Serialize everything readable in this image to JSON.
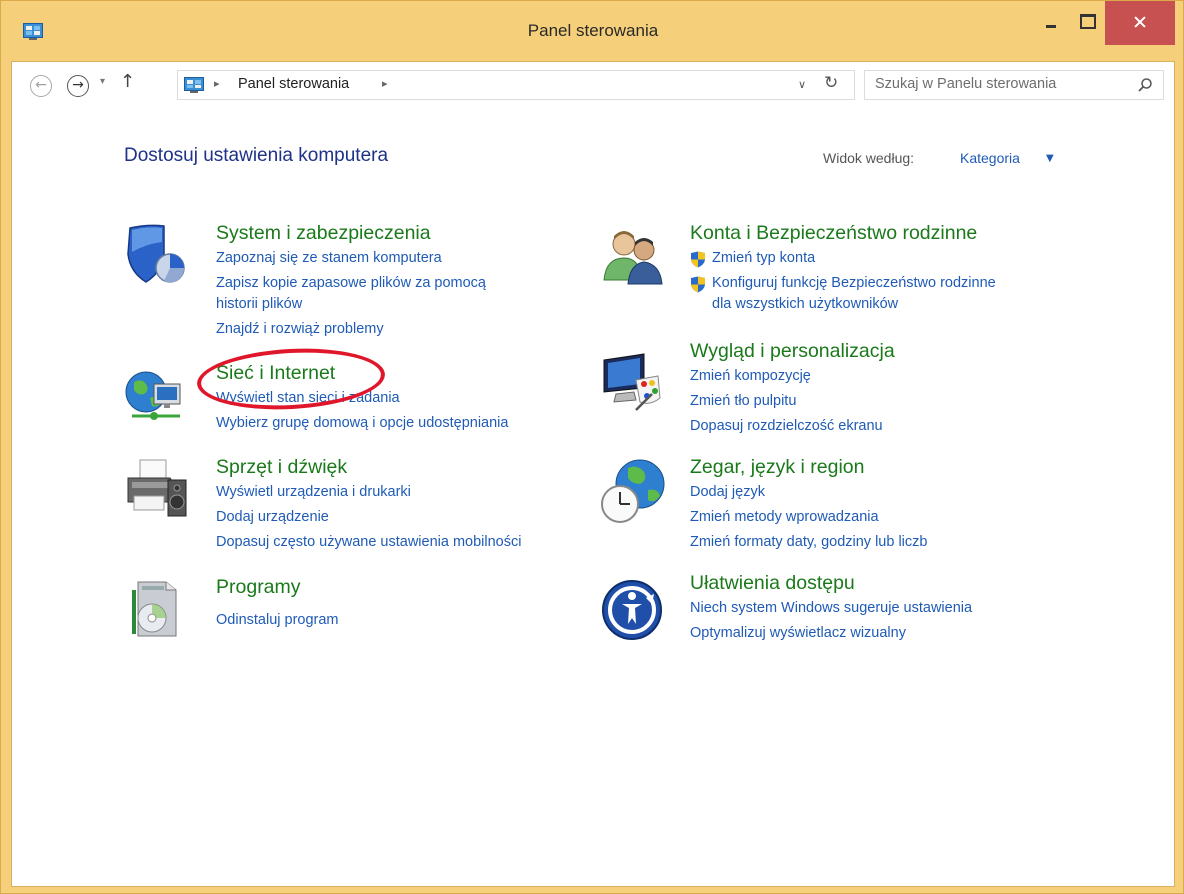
{
  "window": {
    "title": "Panel sterowania",
    "close_color": "#c75050",
    "frame_color": "#f5cf79"
  },
  "nav": {
    "back_icon": "←",
    "forward_icon": "→",
    "recent_icon": "▾",
    "up_icon": "↑",
    "breadcrumb_sep": "▸",
    "breadcrumb": "Panel sterowania",
    "address_dropdown_icon": "∨",
    "refresh_icon": "↻",
    "search_placeholder": "Szukaj w Panelu sterowania"
  },
  "header": {
    "title": "Dostosuj ustawienia komputera",
    "view_label": "Widok według:",
    "view_value": "Kategoria",
    "view_caret": "▼"
  },
  "categories": {
    "system": {
      "title": "System i zabezpieczenia",
      "icon": "shield-icon",
      "links": [
        "Zapoznaj się ze stanem komputera",
        "Zapisz kopie zapasowe plików za pomocą",
        "historii plików",
        "Znajdź i rozwiąż problemy"
      ]
    },
    "network": {
      "title": "Sieć i Internet",
      "icon": "network-globe-icon",
      "links": [
        "Wyświetl stan sieci i zadania",
        "Wybierz grupę domową i opcje udostępniania"
      ]
    },
    "hardware": {
      "title": "Sprzęt i dźwięk",
      "icon": "printer-icon",
      "links": [
        "Wyświetl urządzenia i drukarki",
        "Dodaj urządzenie",
        "Dopasuj często używane ustawienia mobilności"
      ]
    },
    "programs": {
      "title": "Programy",
      "icon": "programs-disc-icon",
      "links": [
        "Odinstaluj program"
      ]
    },
    "accounts": {
      "title": "Konta i Bezpieczeństwo rodzinne",
      "icon": "users-icon",
      "links": [
        "Zmień typ konta",
        "Konfiguruj funkcję Bezpieczeństwo rodzinne",
        "dla wszystkich użytkowników"
      ]
    },
    "appearance": {
      "title": "Wygląd i personalizacja",
      "icon": "monitor-palette-icon",
      "links": [
        "Zmień kompozycję",
        "Zmień tło pulpitu",
        "Dopasuj rozdzielczość ekranu"
      ]
    },
    "clock": {
      "title": "Zegar, język i region",
      "icon": "globe-clock-icon",
      "links": [
        "Dodaj język",
        "Zmień metody wprowadzania",
        "Zmień formaty daty, godziny lub liczb"
      ]
    },
    "ease": {
      "title": "Ułatwienia dostępu",
      "icon": "ease-of-access-icon",
      "links": [
        "Niech system Windows sugeruje ustawienia",
        "Optymalizuj wyświetlacz wizualny"
      ]
    }
  },
  "colors": {
    "category_title": "#1a7a1a",
    "link": "#1f5bb6",
    "page_title": "#1e3287",
    "highlight": "#e0162b"
  }
}
